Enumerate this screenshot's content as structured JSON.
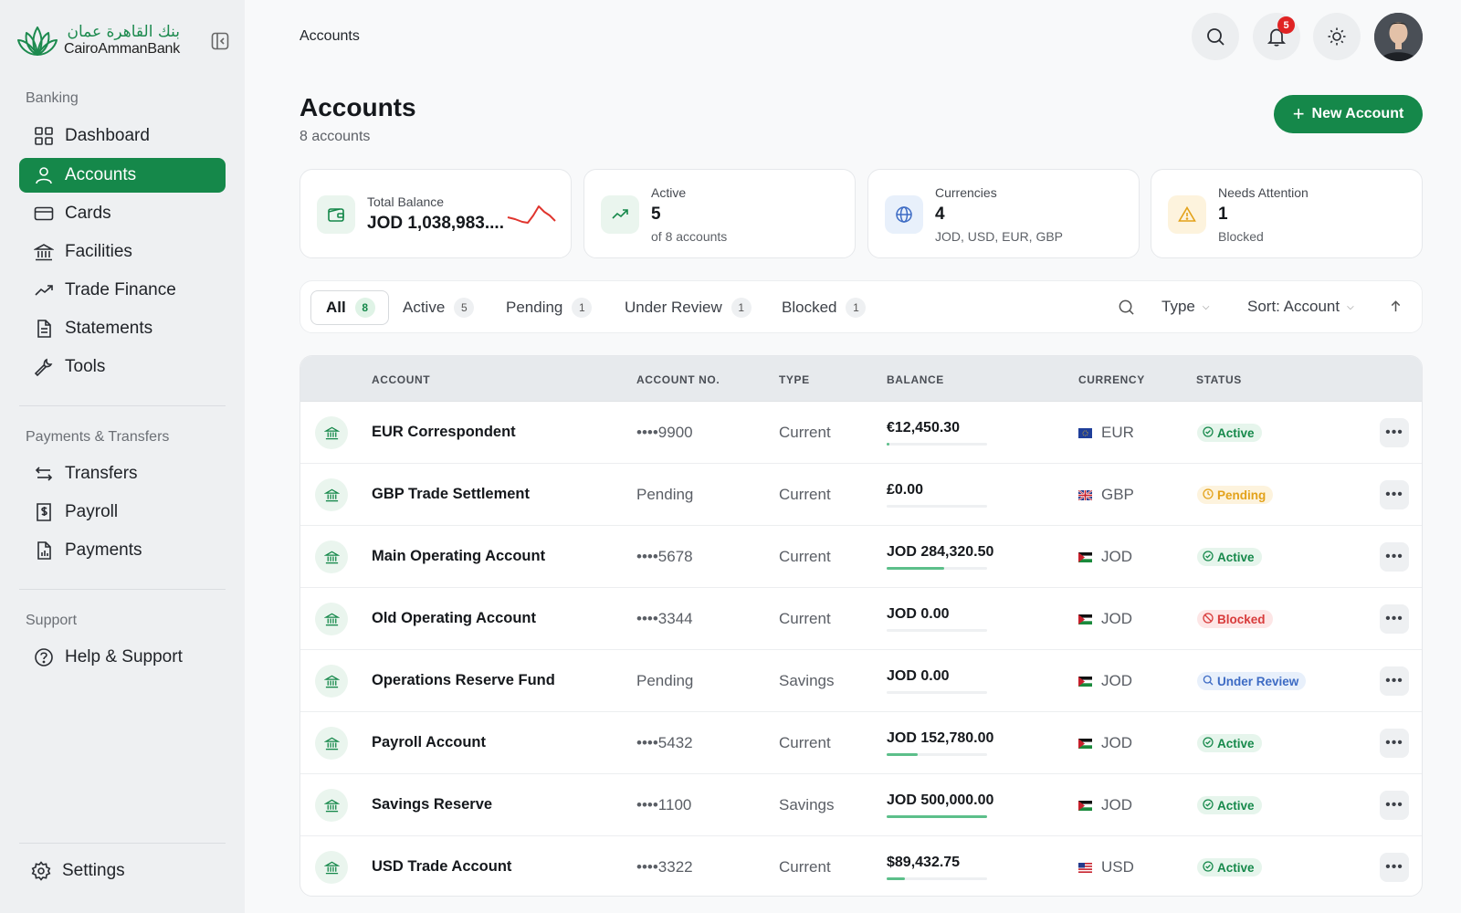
{
  "brand": {
    "arabic": "بنك القاهرة عمان",
    "english": "CairoAmmanBank"
  },
  "sidebar": {
    "sections": [
      {
        "title": "Banking",
        "items": [
          {
            "label": "Dashboard",
            "icon": "grid-icon"
          },
          {
            "label": "Accounts",
            "icon": "user-icon",
            "active": true
          },
          {
            "label": "Cards",
            "icon": "card-icon"
          },
          {
            "label": "Facilities",
            "icon": "bank-icon"
          },
          {
            "label": "Trade Finance",
            "icon": "trend-icon"
          },
          {
            "label": "Statements",
            "icon": "document-icon"
          },
          {
            "label": "Tools",
            "icon": "wrench-icon"
          }
        ]
      },
      {
        "title": "Payments & Transfers",
        "items": [
          {
            "label": "Transfers",
            "icon": "transfer-icon"
          },
          {
            "label": "Payroll",
            "icon": "payroll-icon"
          },
          {
            "label": "Payments",
            "icon": "payments-icon"
          }
        ]
      },
      {
        "title": "Support",
        "items": [
          {
            "label": "Help & Support",
            "icon": "help-icon"
          }
        ]
      }
    ],
    "settings_label": "Settings"
  },
  "topbar": {
    "breadcrumb": "Accounts",
    "notifications_count": "5"
  },
  "header": {
    "title": "Accounts",
    "subtitle": "8 accounts",
    "new_button": "New Account"
  },
  "stats": [
    {
      "label": "Total Balance",
      "value": "JOD 1,038,983....",
      "sub": "",
      "icon": "wallet-icon",
      "accent": "#15884a"
    },
    {
      "label": "Active",
      "value": "5",
      "sub": "of 8 accounts",
      "icon": "trend-up-icon",
      "accent": "#15884a"
    },
    {
      "label": "Currencies",
      "value": "4",
      "sub": "JOD, USD, EUR, GBP",
      "icon": "globe-icon",
      "accent": "#3d6bc4"
    },
    {
      "label": "Needs Attention",
      "value": "1",
      "sub": "Blocked",
      "icon": "warning-icon",
      "accent": "#e3a21a"
    }
  ],
  "tabs": [
    {
      "label": "All",
      "count": "8",
      "active": true
    },
    {
      "label": "Active",
      "count": "5"
    },
    {
      "label": "Pending",
      "count": "1"
    },
    {
      "label": "Under Review",
      "count": "1"
    },
    {
      "label": "Blocked",
      "count": "1"
    }
  ],
  "filters": {
    "type_label": "Type",
    "sort_label": "Sort: Account"
  },
  "table": {
    "columns": [
      "ACCOUNT",
      "ACCOUNT NO.",
      "TYPE",
      "BALANCE",
      "CURRENCY",
      "STATUS"
    ],
    "rows": [
      {
        "name": "EUR Correspondent",
        "number": "••••9900",
        "type": "Current",
        "balance": "€12,450.30",
        "balance_fill": 0.03,
        "currency": "EUR",
        "status": "Active",
        "status_kind": "active"
      },
      {
        "name": "GBP Trade Settlement",
        "number": "Pending",
        "type": "Current",
        "balance": "£0.00",
        "balance_fill": 0,
        "currency": "GBP",
        "status": "Pending",
        "status_kind": "pending"
      },
      {
        "name": "Main Operating Account",
        "number": "••••5678",
        "type": "Current",
        "balance": "JOD 284,320.50",
        "balance_fill": 0.57,
        "currency": "JOD",
        "status": "Active",
        "status_kind": "active"
      },
      {
        "name": "Old Operating Account",
        "number": "••••3344",
        "type": "Current",
        "balance": "JOD 0.00",
        "balance_fill": 0,
        "currency": "JOD",
        "status": "Blocked",
        "status_kind": "blocked"
      },
      {
        "name": "Operations Reserve Fund",
        "number": "Pending",
        "type": "Savings",
        "balance": "JOD 0.00",
        "balance_fill": 0,
        "currency": "JOD",
        "status": "Under Review",
        "status_kind": "review"
      },
      {
        "name": "Payroll Account",
        "number": "••••5432",
        "type": "Current",
        "balance": "JOD 152,780.00",
        "balance_fill": 0.31,
        "currency": "JOD",
        "status": "Active",
        "status_kind": "active"
      },
      {
        "name": "Savings Reserve",
        "number": "••••1100",
        "type": "Savings",
        "balance": "JOD 500,000.00",
        "balance_fill": 1.0,
        "currency": "JOD",
        "status": "Active",
        "status_kind": "active"
      },
      {
        "name": "USD Trade Account",
        "number": "••••3322",
        "type": "Current",
        "balance": "$89,432.75",
        "balance_fill": 0.18,
        "currency": "USD",
        "status": "Active",
        "status_kind": "active"
      }
    ]
  },
  "colors": {
    "brand": "#15884a",
    "spark": "#e0352e"
  }
}
